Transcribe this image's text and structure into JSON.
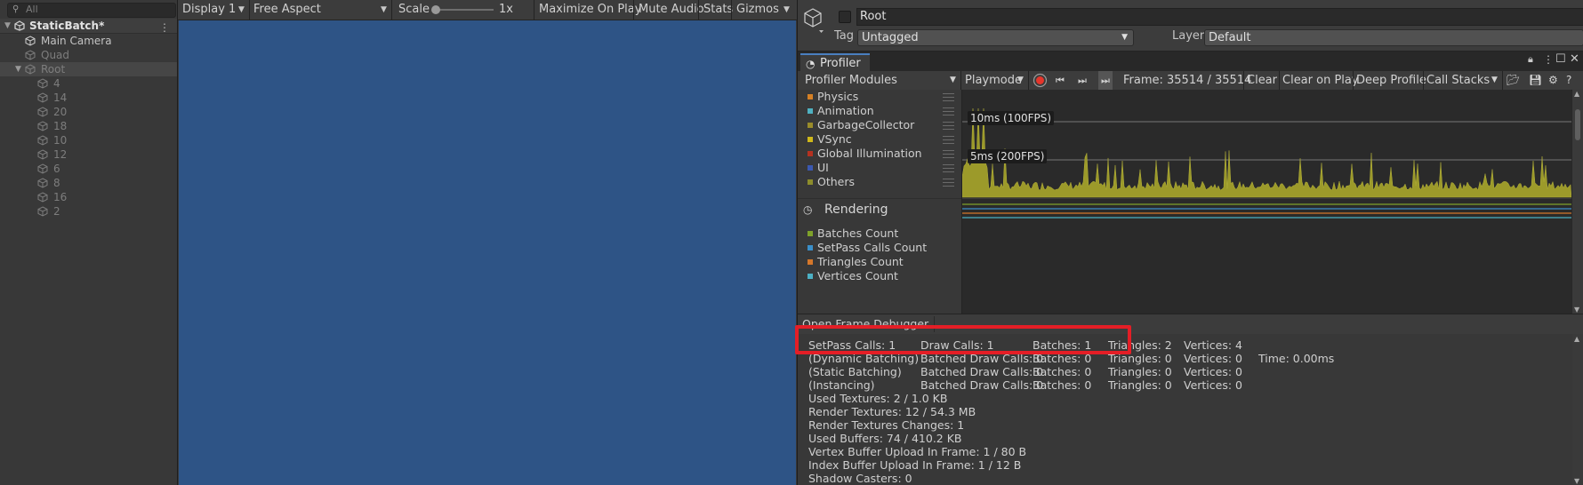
{
  "hierarchy": {
    "search_placeholder": "All",
    "scene": "StaticBatch*",
    "items": [
      {
        "label": "Main Camera",
        "dim": false
      },
      {
        "label": "Quad",
        "dim": true
      },
      {
        "label": "Root",
        "dim": true
      }
    ],
    "children": [
      "4",
      "14",
      "20",
      "18",
      "10",
      "12",
      "6",
      "8",
      "16",
      "2"
    ]
  },
  "game_toolbar": {
    "display": "Display 1",
    "aspect": "Free Aspect",
    "scale_label": "Scale",
    "scale_value": "1x",
    "maximize": "Maximize On Play",
    "mute": "Mute Audio",
    "stats": "Stats",
    "gizmos": "Gizmos"
  },
  "inspector": {
    "name": "Root",
    "tag_label": "Tag",
    "tag_value": "Untagged",
    "layer_label": "Layer",
    "layer_value": "Default"
  },
  "profiler": {
    "tab": "Profiler",
    "modules_dd": "Profiler Modules",
    "playmode": "Playmode",
    "frame": "Frame: 35514 / 35514",
    "clear": "Clear",
    "clear_on_play": "Clear on Play",
    "deep_profile": "Deep Profile",
    "call_stacks": "Call Stacks",
    "cpu_modules": [
      {
        "label": "Physics",
        "color": "#d58024"
      },
      {
        "label": "Animation",
        "color": "#4fb1c1"
      },
      {
        "label": "GarbageCollector",
        "color": "#9a8c2a"
      },
      {
        "label": "VSync",
        "color": "#cfb81a"
      },
      {
        "label": "Global Illumination",
        "color": "#b53120"
      },
      {
        "label": "UI",
        "color": "#3b58b0"
      },
      {
        "label": "Others",
        "color": "#8d8d2b"
      }
    ],
    "rendering_header": "Rendering",
    "rendering_modules": [
      {
        "label": "Batches Count",
        "color": "#7fa22a"
      },
      {
        "label": "SetPass Calls Count",
        "color": "#3a8fc9"
      },
      {
        "label": "Triangles Count",
        "color": "#d5772a"
      },
      {
        "label": "Vertices Count",
        "color": "#4cb0c4"
      }
    ],
    "fps_labels": [
      "10ms (100FPS)",
      "5ms (200FPS)"
    ],
    "frame_debugger": "Open Frame Debugger"
  },
  "stats": {
    "row0": [
      "SetPass Calls: 1",
      "Draw Calls: 1",
      "Batches: 1",
      "Triangles: 2",
      "Vertices: 4"
    ],
    "row1": [
      "(Dynamic Batching)",
      "Batched Draw Calls: 0",
      "Batches: 0",
      "Triangles: 0",
      "Vertices: 0",
      "Time: 0.00ms"
    ],
    "row2": [
      "(Static Batching)",
      "Batched Draw Calls: 0",
      "Batches: 0",
      "Triangles: 0",
      "Vertices: 0"
    ],
    "row3": [
      "(Instancing)",
      "Batched Draw Calls: 0",
      "Batches: 0",
      "Triangles: 0",
      "Vertices: 0"
    ],
    "lines": [
      "Used Textures: 2 / 1.0 KB",
      "Render Textures: 12 / 54.3 MB",
      "Render Textures Changes: 1",
      "Used Buffers: 74 / 410.2 KB",
      "Vertex Buffer Upload In Frame: 1 / 80 B",
      "Index Buffer Upload In Frame: 1 / 12 B",
      "Shadow Casters: 0"
    ]
  }
}
